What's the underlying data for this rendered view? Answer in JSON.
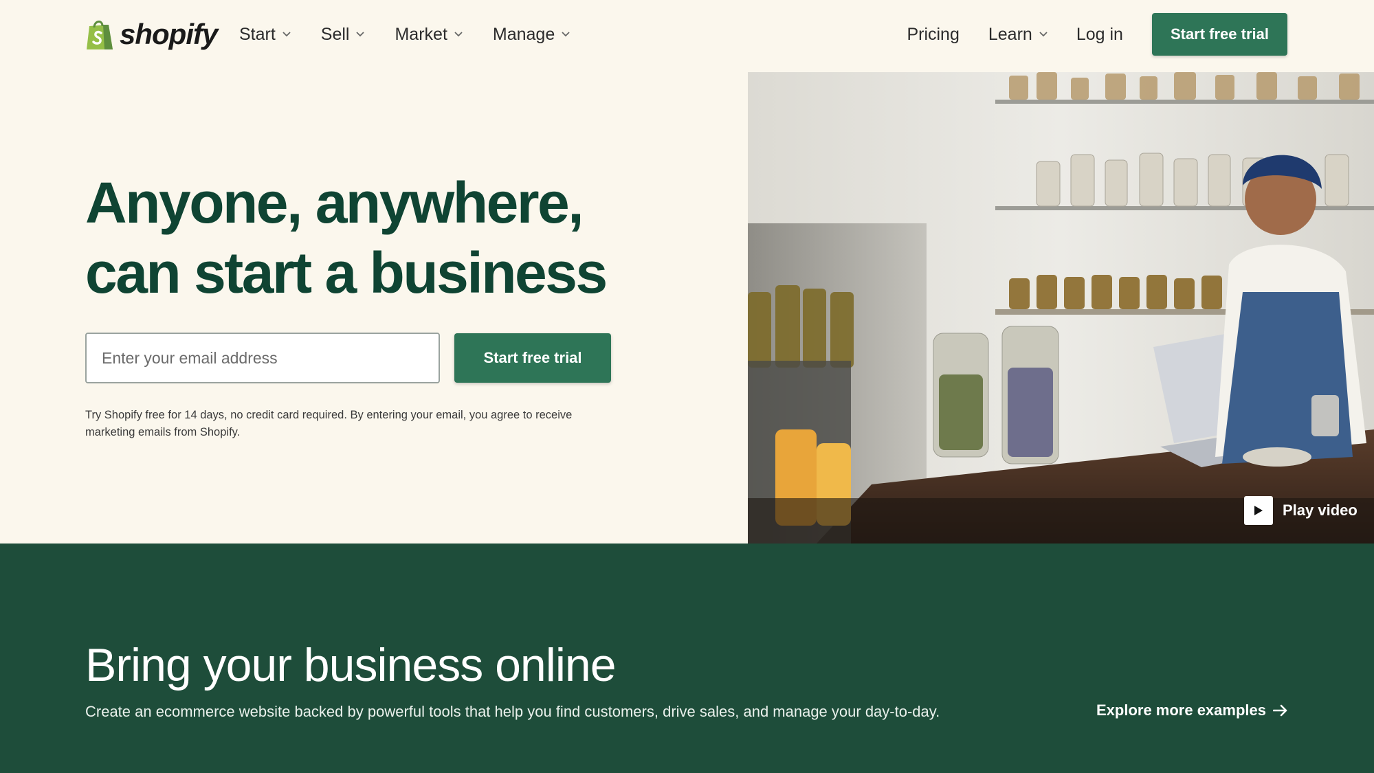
{
  "brand": {
    "name": "shopify",
    "accent": "#2e7557",
    "heading_color": "#0f4433",
    "section_bg": "#1e4d3a",
    "icon": "shopify-bag-icon"
  },
  "nav": {
    "left_items": [
      {
        "label": "Start",
        "icon": "chevron-down-icon"
      },
      {
        "label": "Sell",
        "icon": "chevron-down-icon"
      },
      {
        "label": "Market",
        "icon": "chevron-down-icon"
      },
      {
        "label": "Manage",
        "icon": "chevron-down-icon"
      }
    ],
    "pricing": "Pricing",
    "learn": "Learn",
    "login": "Log in",
    "cta": "Start free trial"
  },
  "hero": {
    "heading_line1": "Anyone, anywhere,",
    "heading_line2": "can start a business",
    "email_placeholder": "Enter your email address",
    "cta": "Start free trial",
    "disclaimer": "Try Shopify free for 14 days, no credit card required. By entering your email, you agree to receive marketing emails from Shopify.",
    "play_video": "Play video",
    "play_icon": "play-icon"
  },
  "online": {
    "title": "Bring your business online",
    "description": "Create an ecommerce website backed by powerful tools that help you find customers, drive sales, and manage your day-to-day.",
    "link": "Explore more examples",
    "link_icon": "arrow-right-icon"
  }
}
